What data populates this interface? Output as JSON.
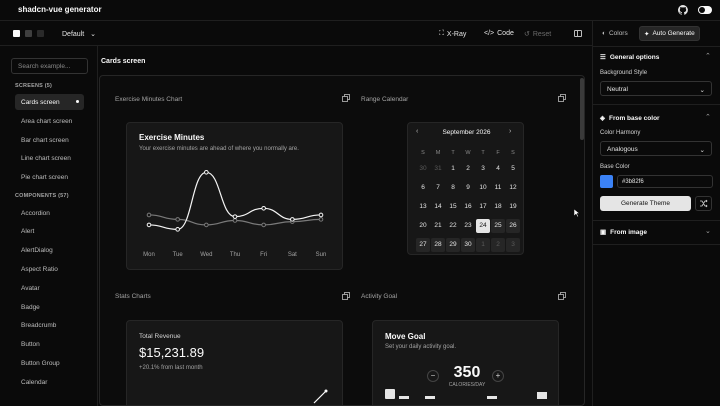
{
  "app": {
    "title": "shadcn-vue generator"
  },
  "toolbar": {
    "style_label": "Default",
    "xray_label": "X-Ray",
    "code_label": "Code",
    "reset_label": "Reset"
  },
  "sidebar": {
    "search_placeholder": "Search example...",
    "screens_heading": "SCREENS (5)",
    "screens": [
      "Cards screen",
      "Area chart screen",
      "Bar chart screen",
      "Line chart screen",
      "Pie chart screen"
    ],
    "components_heading": "COMPONENTS (57)",
    "components": [
      "Accordion",
      "Alert",
      "AlertDialog",
      "Aspect Ratio",
      "Avatar",
      "Badge",
      "Breadcrumb",
      "Button",
      "Button Group",
      "Calendar"
    ]
  },
  "main": {
    "title": "Cards screen",
    "exercise": {
      "panel_label": "Exercise Minutes Chart",
      "title": "Exercise Minutes",
      "subtitle": "Your exercise minutes are ahead of where you normally are.",
      "days": [
        "Mon",
        "Tue",
        "Wed",
        "Thu",
        "Fri",
        "Sat",
        "Sun"
      ]
    },
    "calendar": {
      "panel_label": "Range Calendar",
      "month": "September 2026",
      "weekdays": [
        "S",
        "M",
        "T",
        "W",
        "T",
        "F",
        "S"
      ],
      "weeks": [
        [
          "30",
          "31",
          "1",
          "2",
          "3",
          "4",
          "5"
        ],
        [
          "6",
          "7",
          "8",
          "9",
          "10",
          "11",
          "12"
        ],
        [
          "13",
          "14",
          "15",
          "16",
          "17",
          "18",
          "19"
        ],
        [
          "20",
          "21",
          "22",
          "23",
          "24",
          "25",
          "26"
        ],
        [
          "27",
          "28",
          "29",
          "30",
          "1",
          "2",
          "3"
        ]
      ],
      "selected": "24"
    },
    "stats": {
      "panel_label": "Stats Charts",
      "label": "Total Revenue",
      "value": "$15,231.89",
      "delta": "+20.1% from last month"
    },
    "activity": {
      "panel_label": "Activity Goal",
      "title": "Move Goal",
      "subtitle": "Set your daily activity goal.",
      "value": "350",
      "unit": "CALORIES/DAY",
      "minus": "−",
      "plus": "+"
    }
  },
  "right_panel": {
    "tab_colors": "Colors",
    "tab_auto": "Auto Generate",
    "general_heading": "General options",
    "bg_style_label": "Background Style",
    "bg_style_value": "Neutral",
    "base_color_heading": "From base color",
    "harmony_label": "Color Harmony",
    "harmony_value": "Analogous",
    "base_color_label": "Base Color",
    "base_color_value": "#3b82f6",
    "generate_label": "Generate Theme",
    "image_heading": "From image"
  },
  "chart_data": {
    "type": "line",
    "title": "Exercise Minutes",
    "categories": [
      "Mon",
      "Tue",
      "Wed",
      "Thu",
      "Fri",
      "Sat",
      "Sun"
    ],
    "series": [
      {
        "values": [
          20,
          12,
          115,
          35,
          50,
          30,
          38
        ],
        "color": "#f5f5f5"
      },
      {
        "values": [
          38,
          30,
          20,
          28,
          20,
          26,
          30
        ],
        "color": "#7a7a7a"
      }
    ],
    "ylim": [
      0,
      130
    ]
  }
}
